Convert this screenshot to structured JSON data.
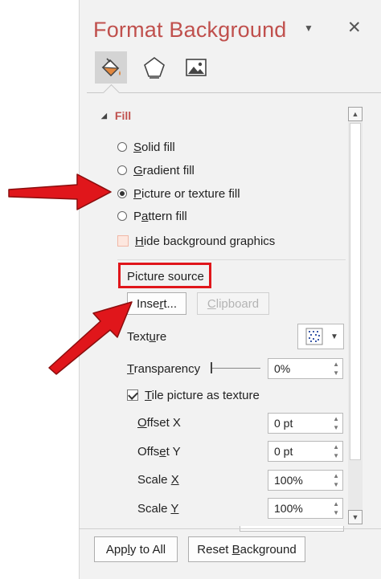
{
  "pane": {
    "title": "Format Background",
    "tabs": [
      {
        "name": "fill-line-tab",
        "icon": "paint-bucket-icon",
        "active": true
      },
      {
        "name": "effects-tab",
        "icon": "pentagon-icon",
        "active": false
      },
      {
        "name": "picture-tab",
        "icon": "picture-icon",
        "active": false
      }
    ]
  },
  "fill": {
    "section_label": "Fill",
    "options": [
      {
        "pre": "",
        "acc": "S",
        "post": "olid fill",
        "selected": false
      },
      {
        "pre": "",
        "acc": "G",
        "post": "radient fill",
        "selected": false
      },
      {
        "pre": "",
        "acc": "P",
        "post": "icture or texture fill",
        "selected": true
      },
      {
        "pre": "P",
        "acc": "a",
        "post": "ttern fill",
        "selected": false
      }
    ],
    "hide_bg": {
      "pre": "",
      "acc": "H",
      "post": "ide background graphics",
      "checked": false
    }
  },
  "picture_source": {
    "label": "Picture source",
    "insert_pre": "Inse",
    "insert_acc": "r",
    "insert_post": "t...",
    "clipboard_pre": "",
    "clipboard_acc": "C",
    "clipboard_post": "lipboard"
  },
  "texture": {
    "pre": "Text",
    "acc": "u",
    "post": "re"
  },
  "transparency": {
    "pre": "",
    "acc": "T",
    "post": "ransparency",
    "value": "0%"
  },
  "tile": {
    "pre": "",
    "acc": "T",
    "post": "ile picture as texture",
    "checked": true
  },
  "offset_x": {
    "pre": "",
    "acc": "O",
    "post": "ffset X",
    "value": "0 pt"
  },
  "offset_y": {
    "pre": "Offs",
    "acc": "e",
    "post": "t Y",
    "value": "0 pt"
  },
  "scale_x": {
    "pre": "Scale ",
    "acc": "X",
    "post": "",
    "value": "100%"
  },
  "scale_y": {
    "pre": "Scale ",
    "acc": "Y",
    "post": "",
    "value": "100%"
  },
  "footer": {
    "apply_pre": "App",
    "apply_acc": "l",
    "apply_post": "y to All",
    "reset_pre": "Reset ",
    "reset_acc": "B",
    "reset_post": "ackground"
  },
  "colors": {
    "title": "#c0504d",
    "highlight_box": "#e0161b",
    "arrow": "#e0161b"
  }
}
